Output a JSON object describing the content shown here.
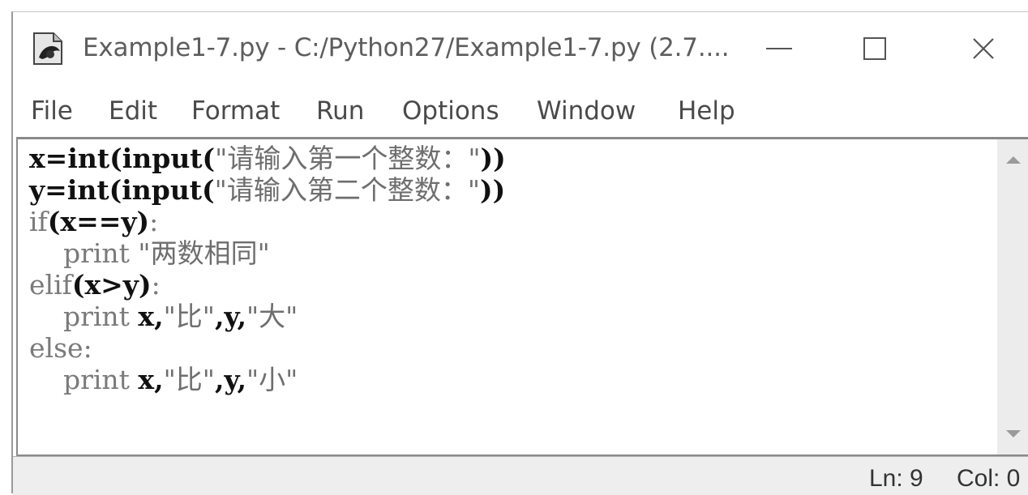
{
  "window": {
    "title": "Example1-7.py - C:/Python27/Example1-7.py (2.7....",
    "icons": {
      "app": "python-file-icon",
      "minimize": "minimize-icon",
      "maximize": "maximize-icon",
      "close": "close-icon"
    }
  },
  "menu": {
    "items": [
      "File",
      "Edit",
      "Format",
      "Run",
      "Options",
      "Window",
      "Help"
    ]
  },
  "editor": {
    "lines": [
      [
        {
          "t": "x=int(input(",
          "c": "bold"
        },
        {
          "t": "\"请输入第一个整数：\"",
          "c": "str"
        },
        {
          "t": "))",
          "c": "bold"
        }
      ],
      [
        {
          "t": "y=int(input(",
          "c": "bold"
        },
        {
          "t": "\"请输入第二个整数：\"",
          "c": "str"
        },
        {
          "t": "))",
          "c": "bold"
        }
      ],
      [
        {
          "t": "if",
          "c": "kw"
        },
        {
          "t": "(x==y)",
          "c": "bold"
        },
        {
          "t": ":",
          "c": "kw"
        }
      ],
      [
        {
          "t": "    print ",
          "c": "kw"
        },
        {
          "t": "\"两数相同\"",
          "c": "str"
        }
      ],
      [
        {
          "t": "elif",
          "c": "kw"
        },
        {
          "t": "(x>y)",
          "c": "bold"
        },
        {
          "t": ":",
          "c": "kw"
        }
      ],
      [
        {
          "t": "    print ",
          "c": "kw"
        },
        {
          "t": "x,",
          "c": "bold"
        },
        {
          "t": "\"比\"",
          "c": "str"
        },
        {
          "t": ",y,",
          "c": "bold"
        },
        {
          "t": "\"大\"",
          "c": "str"
        }
      ],
      [
        {
          "t": "else",
          "c": "kw"
        },
        {
          "t": ":",
          "c": "kw"
        }
      ],
      [
        {
          "t": "    print ",
          "c": "kw"
        },
        {
          "t": "x,",
          "c": "bold"
        },
        {
          "t": "\"比\"",
          "c": "str"
        },
        {
          "t": ",y,",
          "c": "bold"
        },
        {
          "t": "\"小\"",
          "c": "str"
        }
      ]
    ]
  },
  "scrollbar": {
    "up_icon": "scroll-up-arrow-icon",
    "down_icon": "scroll-down-arrow-icon"
  },
  "status": {
    "ln": "Ln: 9",
    "col": "Col: 0"
  }
}
